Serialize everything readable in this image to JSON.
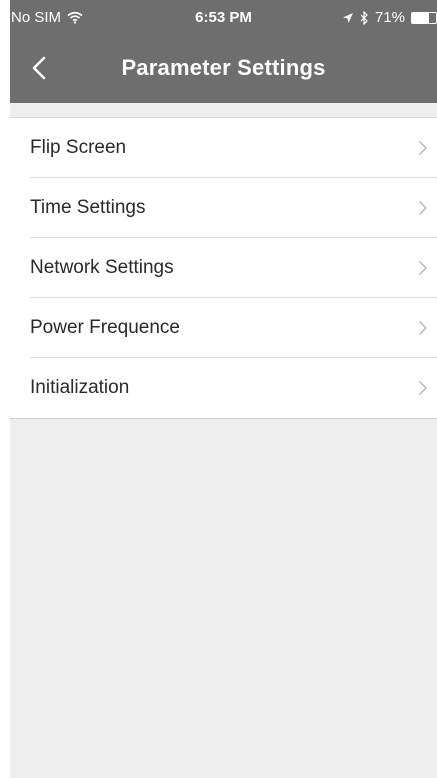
{
  "status_bar": {
    "carrier": "No SIM",
    "time": "6:53 PM",
    "battery_text": "71%",
    "battery_level": 0.71,
    "icons": [
      "wifi-icon",
      "location-arrow-icon",
      "bluetooth-icon",
      "battery-icon"
    ]
  },
  "nav": {
    "title": "Parameter Settings",
    "back_icon": "chevron-left-icon"
  },
  "settings": {
    "items": [
      {
        "label": "Flip Screen"
      },
      {
        "label": "Time Settings"
      },
      {
        "label": "Network Settings"
      },
      {
        "label": "Power Frequence"
      },
      {
        "label": "Initialization"
      }
    ]
  },
  "colors": {
    "nav_background": "#6e6e6e",
    "page_background": "#eeeeee",
    "list_background": "#ffffff",
    "text": "#2a2a2a",
    "chevron": "#b5b5b5"
  }
}
